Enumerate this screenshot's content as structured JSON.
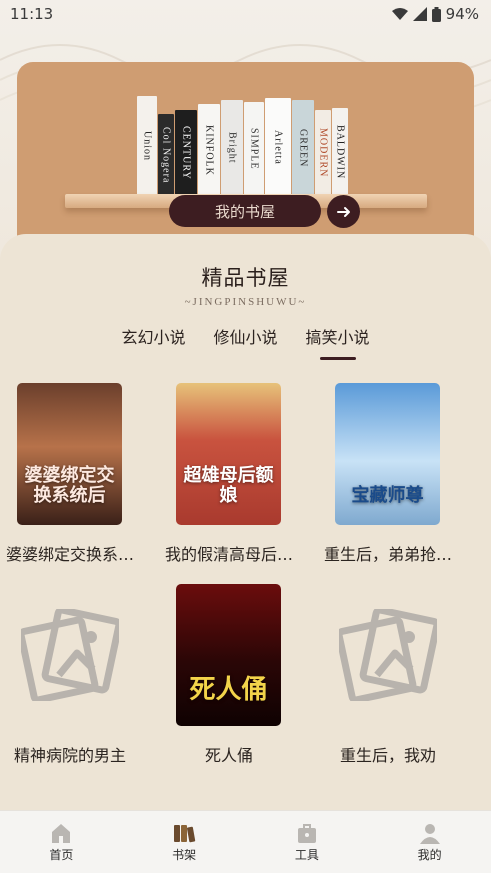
{
  "status_bar": {
    "time": "11:13",
    "battery": "94%"
  },
  "banner": {
    "books": [
      {
        "text": "Union",
        "bg": "#f4f1ec",
        "fg": "#222",
        "w": 20,
        "h": 100
      },
      {
        "text": "Col Nogera",
        "bg": "#2b2b2b",
        "fg": "#eee",
        "w": 16,
        "h": 82
      },
      {
        "text": "CENTURY",
        "bg": "#1e1e1e",
        "fg": "#fff",
        "w": 22,
        "h": 86
      },
      {
        "text": "KINFOLK",
        "bg": "#f7f6f3",
        "fg": "#222",
        "w": 22,
        "h": 92
      },
      {
        "text": "Bright",
        "bg": "#e9e8e6",
        "fg": "#333",
        "w": 22,
        "h": 96
      },
      {
        "text": "SIMPLE",
        "bg": "#f5f5f3",
        "fg": "#333",
        "w": 20,
        "h": 94
      },
      {
        "text": "Arletta",
        "bg": "#fbfbfa",
        "fg": "#222",
        "w": 26,
        "h": 98
      },
      {
        "text": "GREEN",
        "bg": "#c9d6d9",
        "fg": "#333",
        "w": 22,
        "h": 96
      },
      {
        "text": "MODERN",
        "bg": "#f2ece4",
        "fg": "#b04a2a",
        "w": 16,
        "h": 86
      },
      {
        "text": "BALDWIN",
        "bg": "#f4f2ef",
        "fg": "#222",
        "w": 16,
        "h": 88
      }
    ],
    "button_label": "我的书屋"
  },
  "section": {
    "title": "精品书屋",
    "subtitle": "~JINGPINSHUWU~",
    "tabs": [
      "玄幻小说",
      "修仙小说",
      "搞笑小说"
    ],
    "active_tab": 2
  },
  "books": [
    {
      "title": "婆婆绑定交换系统后",
      "cover": "romance",
      "cover_text": "婆婆绑定交换系统后"
    },
    {
      "title": "我的假清高母后额娘",
      "cover": "red",
      "cover_text": "超雄母后额娘"
    },
    {
      "title": "重生后，弟弟抢走我的宝藏师尊",
      "cover": "blue",
      "cover_text": "宝藏师尊"
    },
    {
      "title": "精神病院的男主",
      "cover": "placeholder"
    },
    {
      "title": "死人俑",
      "cover": "horror",
      "cover_text": "死人俑"
    },
    {
      "title": "重生后，我劝",
      "cover": "placeholder"
    }
  ],
  "nav": [
    {
      "label": "首页",
      "icon": "home-icon",
      "active": false
    },
    {
      "label": "书架",
      "icon": "bookshelf-icon",
      "active": true
    },
    {
      "label": "工具",
      "icon": "toolbox-icon",
      "active": false
    },
    {
      "label": "我的",
      "icon": "profile-icon",
      "active": false
    }
  ],
  "colors": {
    "accent": "#3d1d21",
    "banner": "#cf9d72",
    "panel": "#ede4d5"
  }
}
